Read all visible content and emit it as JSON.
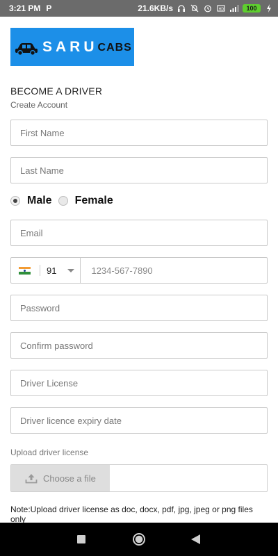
{
  "status_bar": {
    "time": "3:21 PM",
    "app_icon": "P",
    "net_speed": "21.6KB/s",
    "battery": "100",
    "icons": [
      "headphones-icon",
      "mute-icon",
      "alarm-icon",
      "volte-icon",
      "signal-icon",
      "charging-icon"
    ]
  },
  "logo": {
    "part1": "SARU",
    "part2": "CABS",
    "icon": "car-icon"
  },
  "form": {
    "title": "BECOME A DRIVER",
    "subtitle": "Create Account",
    "first_name_placeholder": "First Name",
    "last_name_placeholder": "Last Name",
    "gender": {
      "male": "Male",
      "female": "Female",
      "selected": "Male"
    },
    "email_placeholder": "Email",
    "phone": {
      "country_code": "91",
      "placeholder": "1234-567-7890",
      "flag": "india-flag-icon"
    },
    "password_placeholder": "Password",
    "confirm_password_placeholder": "Confirm password",
    "driver_license_placeholder": "Driver License",
    "license_expiry_placeholder": "Driver licence expiry date",
    "upload_label": "Upload driver license",
    "choose_file": "Choose a file",
    "note": "Note:Upload driver license as doc, docx, pdf, jpg, jpeg or png files only"
  },
  "colors": {
    "logo_bg": "#1c8fe8",
    "status_bar": "#6b6b6b",
    "battery": "#5ecf2e"
  }
}
